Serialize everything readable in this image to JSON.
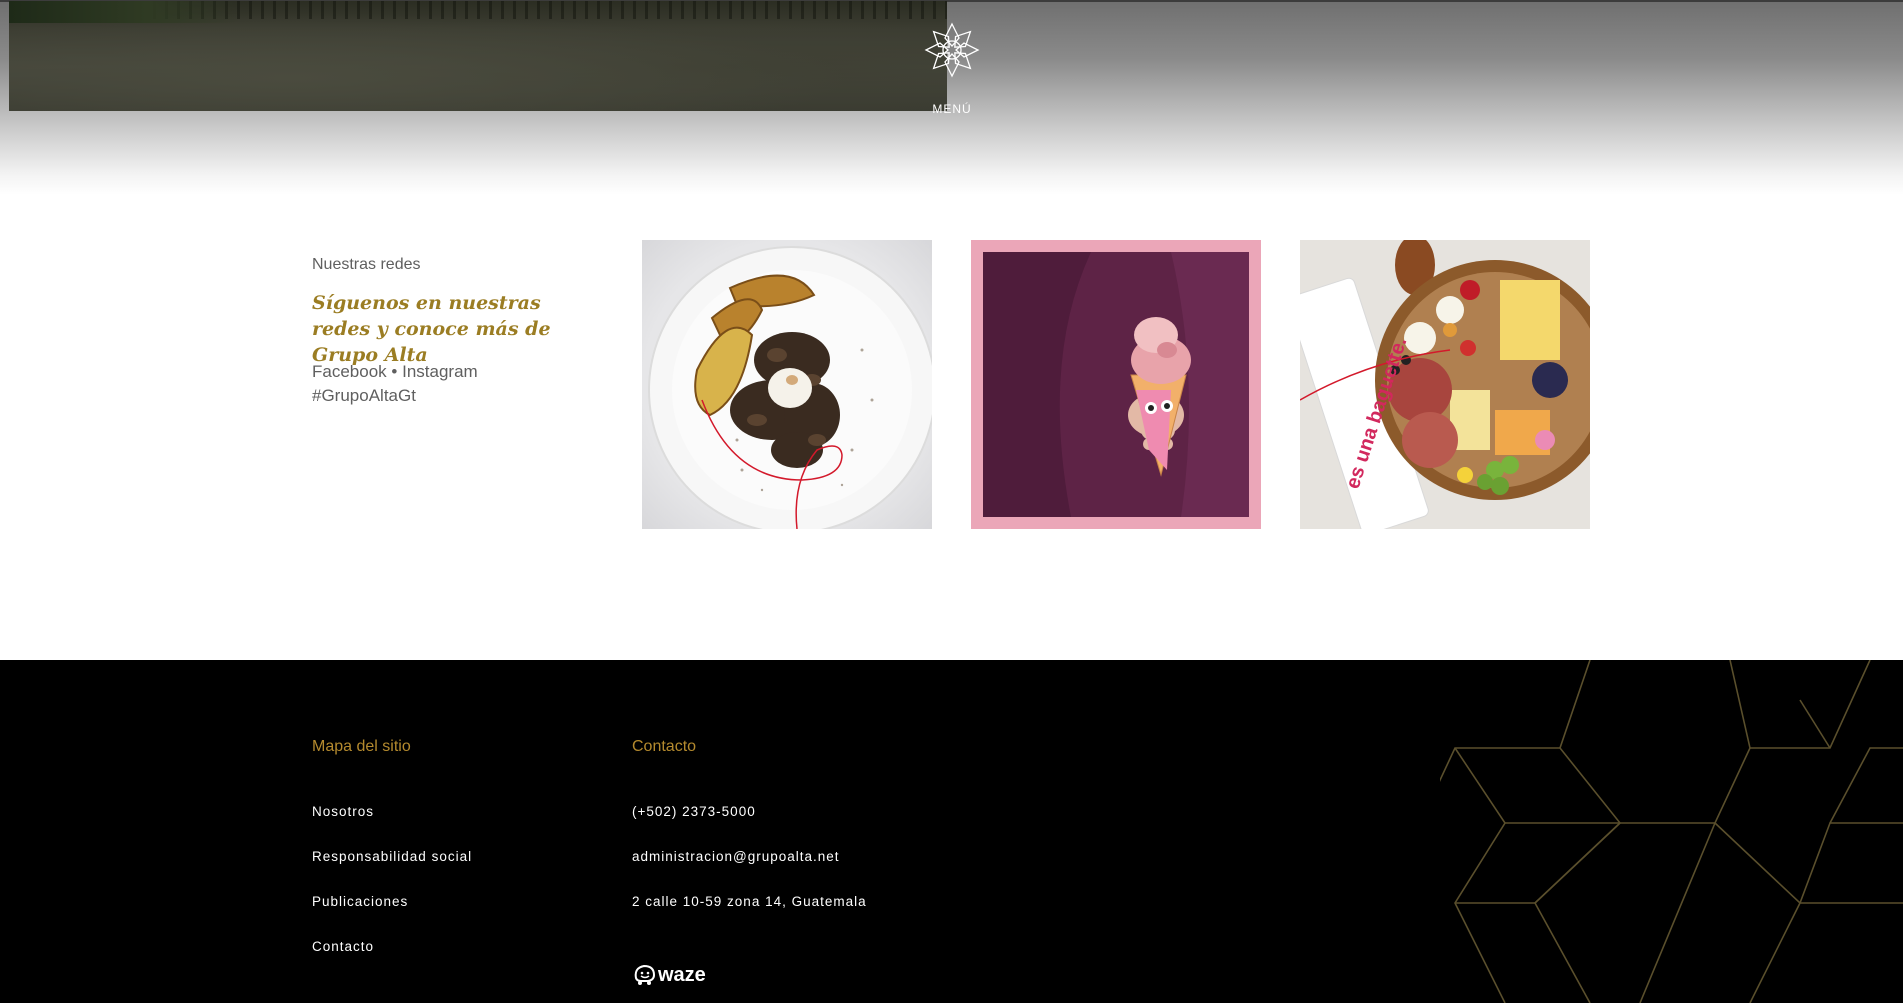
{
  "header": {
    "menu_label": "MENÚ"
  },
  "social": {
    "eyebrow": "Nuestras redes",
    "headline": "Síguenos en nuestras redes y conoce más de Grupo Alta",
    "links": [
      "Facebook",
      "Instagram"
    ],
    "separator": "•",
    "hashtag": "#GrupoAltaGt",
    "tiles": [
      {
        "icon": "mushroom-toast-dish-photo"
      },
      {
        "icon": "ice-cream-cone-photo"
      },
      {
        "icon": "charcuterie-board-photo",
        "label": "es una baguette."
      }
    ]
  },
  "footer": {
    "sitemap": {
      "heading": "Mapa del sitio",
      "items": [
        "Nosotros",
        "Responsabilidad social",
        "Publicaciones",
        "Contacto"
      ]
    },
    "contact": {
      "heading": "Contacto",
      "phone": "(+502) 2373-5000",
      "email": "administracion@grupoalta.net",
      "address": "2 calle 10-59 zona 14, Guatemala",
      "waze_label": "waze"
    }
  },
  "colors": {
    "accent_gold": "#9b7d23",
    "footer_heading": "#b48a2e",
    "footer_bg": "#000000",
    "pink_frame": "#eba6b8",
    "purple_shirt": "#5e2346"
  }
}
